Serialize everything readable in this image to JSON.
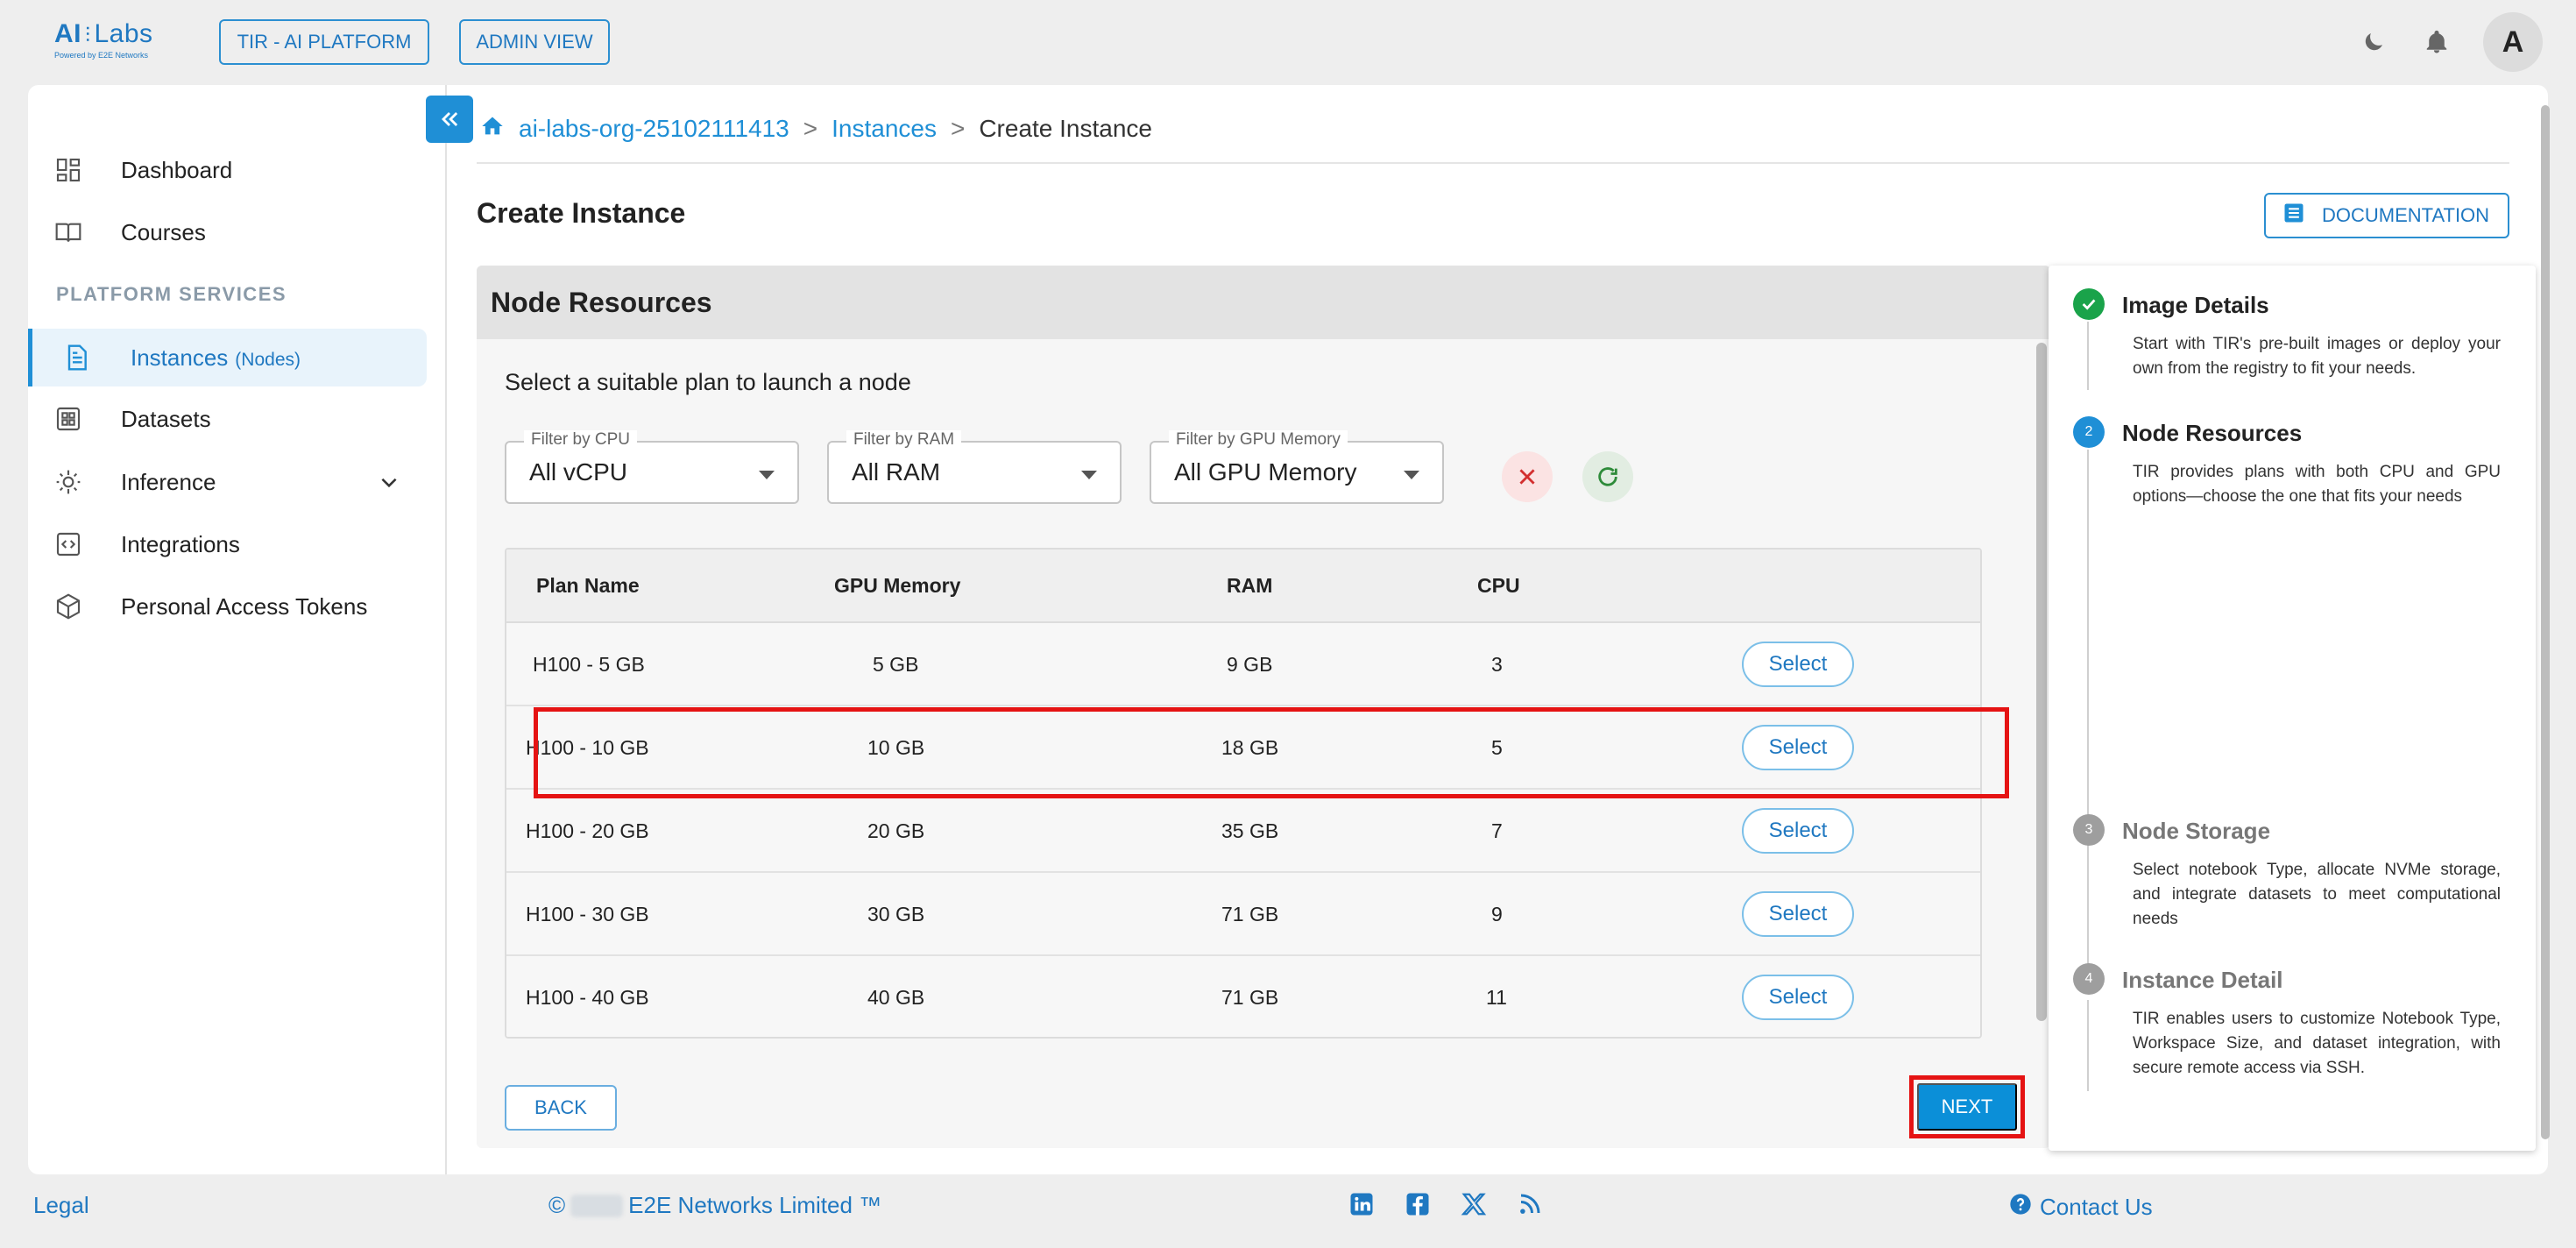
{
  "brand": {
    "name_prefix": "AI",
    "name_suffix": "Labs",
    "tagline": "Powered by E2E Networks"
  },
  "topbar": {
    "platform_btn": "TIR - AI PLATFORM",
    "admin_btn": "ADMIN VIEW",
    "avatar_letter": "A"
  },
  "sidebar": {
    "section_label": "PLATFORM SERVICES",
    "items": [
      {
        "label": "Dashboard",
        "icon": "dashboard-icon"
      },
      {
        "label": "Courses",
        "icon": "book-icon"
      },
      {
        "label": "Instances",
        "tag": "(Nodes)",
        "icon": "document-icon",
        "active": true
      },
      {
        "label": "Datasets",
        "icon": "grid-icon"
      },
      {
        "label": "Inference",
        "icon": "inference-icon"
      },
      {
        "label": "Integrations",
        "icon": "code-icon"
      },
      {
        "label": "Personal Access Tokens",
        "icon": "cube-icon"
      }
    ]
  },
  "breadcrumb": {
    "org": "ai-labs-org-25102111413",
    "section": "Instances",
    "current": "Create Instance",
    "separator": ">"
  },
  "page": {
    "title": "Create Instance",
    "doc_btn": "DOCUMENTATION"
  },
  "panel": {
    "title": "Node Resources",
    "subtitle": "Select a suitable plan to launch a node",
    "filters": [
      {
        "label": "Filter by CPU",
        "value": "All vCPU"
      },
      {
        "label": "Filter by RAM",
        "value": "All RAM"
      },
      {
        "label": "Filter by GPU Memory",
        "value": "All GPU Memory"
      }
    ],
    "columns": [
      "Plan Name",
      "GPU Memory",
      "RAM",
      "CPU"
    ],
    "rows": [
      {
        "plan": "H100 - 5 GB",
        "gpu": "5 GB",
        "ram": "9 GB",
        "cpu": "3",
        "action": "Select"
      },
      {
        "plan": "H100 - 10 GB",
        "gpu": "10 GB",
        "ram": "18 GB",
        "cpu": "5",
        "action": "Select"
      },
      {
        "plan": "H100 - 20 GB",
        "gpu": "20 GB",
        "ram": "35 GB",
        "cpu": "7",
        "action": "Select"
      },
      {
        "plan": "H100 - 30 GB",
        "gpu": "30 GB",
        "ram": "71 GB",
        "cpu": "9",
        "action": "Select"
      },
      {
        "plan": "H100 - 40 GB",
        "gpu": "40 GB",
        "ram": "71 GB",
        "cpu": "11",
        "action": "Select"
      }
    ],
    "back_btn": "BACK",
    "next_btn": "NEXT"
  },
  "stepper": [
    {
      "num": "1",
      "title": "Image Details",
      "state": "done",
      "desc": "Start with TIR's pre-built images or deploy your own from the registry to fit your needs."
    },
    {
      "num": "2",
      "title": "Node Resources",
      "state": "active",
      "desc": "TIR provides plans with both CPU and GPU options—choose the one that fits your needs"
    },
    {
      "num": "3",
      "title": "Node Storage",
      "state": "pending",
      "desc": "Select notebook Type, allocate NVMe storage, and integrate datasets to meet computational needs"
    },
    {
      "num": "4",
      "title": "Instance Detail",
      "state": "pending",
      "desc": "TIR enables users to customize Notebook Type, Workspace Size, and dataset integration, with secure remote access via SSH."
    }
  ],
  "footer": {
    "legal": "Legal",
    "copyright_symbol": "©",
    "company": "E2E Networks Limited ™",
    "contact": "Contact Us"
  },
  "colors": {
    "accent": "#1f8fd6",
    "highlight": "#e51313",
    "success": "#1aa34a",
    "muted": "#9e9e9e"
  }
}
